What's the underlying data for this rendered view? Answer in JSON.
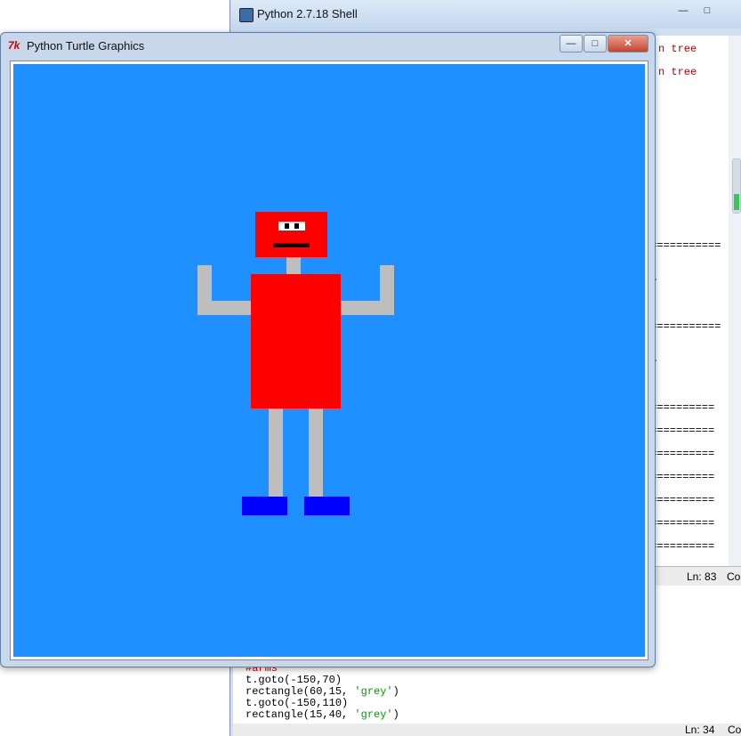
{
  "shell": {
    "title": "Python 2.7.18 Shell",
    "minimize_label": "—",
    "maximize_label": "□",
    "close_label": "✕",
    "output_lines": [
      {
        "text": "n tree",
        "color": "red"
      },
      {
        "text": "n tree",
        "color": "red"
      },
      {
        "text": "e",
        "color": "red"
      },
      {
        "text": "============",
        "color": "dark"
      },
      {
        "text": "e>",
        "color": "red"
      },
      {
        "text": "============",
        "color": "dark"
      },
      {
        "text": "e>",
        "color": "red"
      },
      {
        "text": " ===========",
        "color": "dark"
      },
      {
        "text": " ===========",
        "color": "dark"
      },
      {
        "text": " ===========",
        "color": "dark"
      },
      {
        "text": " ===========",
        "color": "dark"
      },
      {
        "text": " ===========",
        "color": "dark"
      },
      {
        "text": " ===========",
        "color": "dark"
      },
      {
        "text": " ===========",
        "color": "dark"
      }
    ],
    "status": {
      "ln": "Ln: 83",
      "col": "Col"
    }
  },
  "editor": {
    "lines": [
      {
        "code": "#arms",
        "kind": "comment"
      },
      {
        "code": "t.goto(-150,70)",
        "kind": "plain"
      },
      {
        "code_prefix": "rectangle(60,15, ",
        "string": "'grey'",
        "code_suffix": ")",
        "kind": "call"
      },
      {
        "code": "t.goto(-150,110)",
        "kind": "plain"
      },
      {
        "code_prefix": "rectangle(15,40, ",
        "string": "'grey'",
        "code_suffix": ")",
        "kind": "call"
      }
    ],
    "status": {
      "ln": "Ln: 34",
      "col": "Col"
    }
  },
  "turtle_window": {
    "title": "Python Turtle Graphics",
    "icon_text": "7k",
    "minimize_label": "—",
    "maximize_label": "□",
    "close_label": "✕",
    "canvas_color": "#1e90ff"
  },
  "robot": {
    "colors": {
      "head": "#ff0000",
      "body": "#ff0000",
      "limbs": "#bebebe",
      "feet": "#0000ff",
      "eye": "#ffffff",
      "pupil": "#000000",
      "mouth": "#000000"
    }
  }
}
